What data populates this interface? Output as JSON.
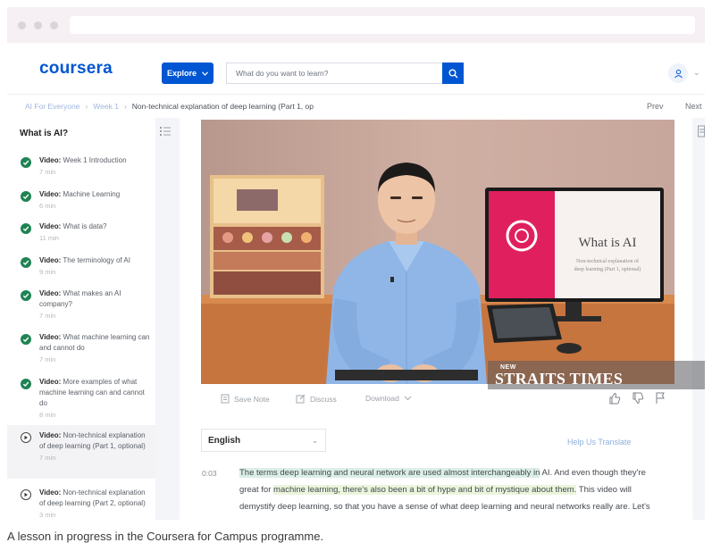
{
  "header": {
    "logo": "coursera",
    "explore_label": "Explore",
    "search_placeholder": "What do you want to learn?"
  },
  "breadcrumb": {
    "items": [
      "AI For Everyone",
      "Week 1"
    ],
    "current": "Non-technical explanation of deep learning (Part 1, op",
    "prev": "Prev",
    "next": "Next"
  },
  "sidebar": {
    "title": "What is AI?",
    "items": [
      {
        "kind": "Video:",
        "title": "Week 1 Introduction",
        "duration": "7 min",
        "status": "done"
      },
      {
        "kind": "Video:",
        "title": "Machine Learning",
        "duration": "6 min",
        "status": "done"
      },
      {
        "kind": "Video:",
        "title": "What is data?",
        "duration": "11 min",
        "status": "done"
      },
      {
        "kind": "Video:",
        "title": "The terminology of AI",
        "duration": "9 min",
        "status": "done"
      },
      {
        "kind": "Video:",
        "title": "What makes an AI company?",
        "duration": "7 min",
        "status": "done"
      },
      {
        "kind": "Video:",
        "title": "What machine learning can and cannot do",
        "duration": "7 min",
        "status": "done"
      },
      {
        "kind": "Video:",
        "title": "More examples of what machine learning can and cannot do",
        "duration": "8 min",
        "status": "done"
      },
      {
        "kind": "Video:",
        "title": "Non-technical explanation of deep learning (Part 1, optional)",
        "duration": "7 min",
        "status": "current"
      },
      {
        "kind": "Video:",
        "title": "Non-technical explanation of deep learning (Part 2, optional)",
        "duration": "3 min",
        "status": "upcoming"
      }
    ]
  },
  "video": {
    "slide_title": "What is AI",
    "slide_subtitle_1": "Non-technical explanation of",
    "slide_subtitle_2": "deep learning (Part 1, optional)",
    "watermark_small": "NEW",
    "watermark_big": "STRAITS TIMES"
  },
  "toolbar": {
    "save_note": "Save Note",
    "discuss": "Discuss",
    "download": "Download"
  },
  "transcript": {
    "language": "English",
    "help_translate": "Help Us Translate",
    "timestamp": "0:03",
    "seg1": "The terms deep learning and neural network are used almost interchangeably in",
    "seg2": " AI. And even though they're great for ",
    "seg3": "machine learning, there's also been a bit of hype and bit of mystique about them.",
    "seg4": " This video will demystify deep learning, so that you have a sense of what deep learning and neural networks really are. Let's use an example from demand prediction. Let's say"
  },
  "caption": "A lesson in progress in the Coursera for Campus programme.",
  "colors": {
    "brand": "#0056d2",
    "check": "#1f8354",
    "slide_accent": "#e0205e"
  }
}
